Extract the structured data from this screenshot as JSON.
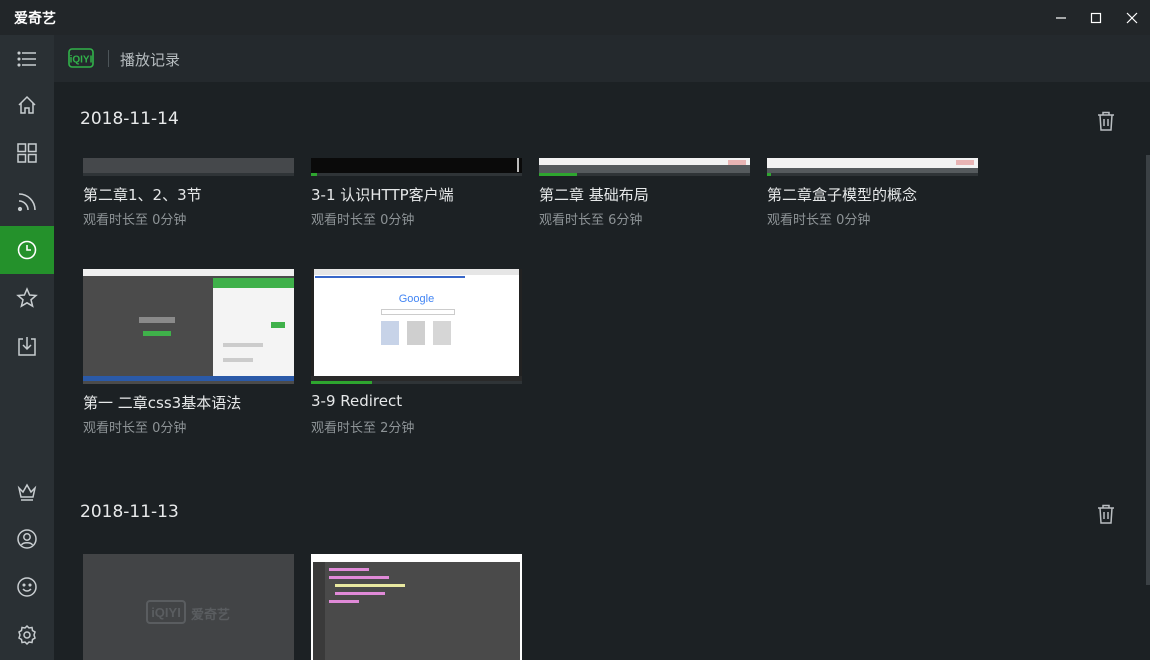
{
  "app": {
    "title": "爱奇艺"
  },
  "header": {
    "logo_text": "iQIYI",
    "page_title": "播放记录"
  },
  "sidebar": {
    "items": [
      {
        "icon": "menu-icon"
      },
      {
        "icon": "home-icon"
      },
      {
        "icon": "grid-icon"
      },
      {
        "icon": "rss-icon"
      },
      {
        "icon": "clock-icon",
        "active": true
      },
      {
        "icon": "star-icon"
      },
      {
        "icon": "download-icon"
      },
      {
        "icon": "crown-icon"
      },
      {
        "icon": "user-icon"
      },
      {
        "icon": "smile-icon"
      },
      {
        "icon": "gear-icon"
      }
    ]
  },
  "sections": [
    {
      "date": "2018-11-14",
      "items": [
        {
          "title": "第二章1、2、3节",
          "subtitle": "观看时长至 0分钟",
          "progress": 0.0
        },
        {
          "title": "3-1 认识HTTP客户端",
          "subtitle": "观看时长至 0分钟",
          "progress": 0.03
        },
        {
          "title": "第二章 基础布局",
          "subtitle": "观看时长至 6分钟",
          "progress": 0.18
        },
        {
          "title": "第二章盒子模型的概念",
          "subtitle": "观看时长至 0分钟",
          "progress": 0.02
        },
        {
          "title": "第一 二章css3基本语法",
          "subtitle": "观看时长至 0分钟",
          "progress": 0.0
        },
        {
          "title": "3-9 Redirect",
          "subtitle": "观看时长至 2分钟",
          "progress": 0.29
        }
      ]
    },
    {
      "date": "2018-11-13",
      "items": [
        {
          "title": "",
          "subtitle": "",
          "watermark": "爱奇艺"
        },
        {
          "title": "",
          "subtitle": ""
        }
      ]
    }
  ],
  "thumb_text": {
    "google": "Google"
  },
  "colors": {
    "accent": "#24912b",
    "progress": "#2ea52f",
    "background": "#1c2124"
  }
}
